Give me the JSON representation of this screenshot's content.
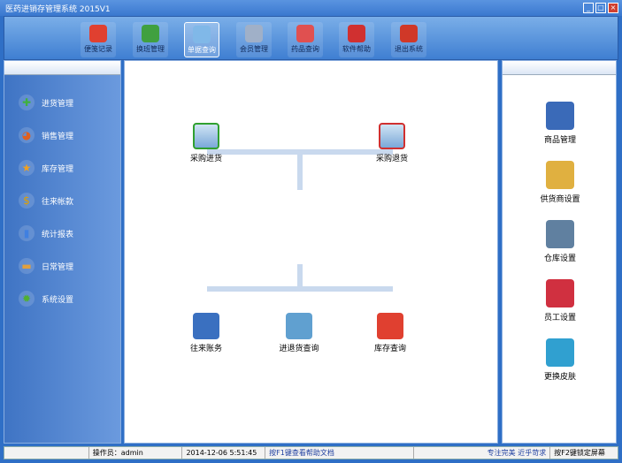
{
  "window": {
    "title": "医药进销存管理系统 2015V1",
    "min": "_",
    "max": "□",
    "close": "×"
  },
  "toolbar": [
    {
      "label": "便笺记录",
      "icon": "notepad-icon",
      "color": "#e04030"
    },
    {
      "label": "换班管理",
      "icon": "users-swap-icon",
      "color": "#40a040"
    },
    {
      "label": "单据查询",
      "icon": "magnifier-icon",
      "color": "#80b8e8",
      "active": true
    },
    {
      "label": "会员管理",
      "icon": "members-icon",
      "color": "#a0b0c8"
    },
    {
      "label": "药品查询",
      "icon": "medicine-icon",
      "color": "#e05050"
    },
    {
      "label": "软件帮助",
      "icon": "help-icon",
      "color": "#d03030"
    },
    {
      "label": "退出系统",
      "icon": "power-icon",
      "color": "#d03828"
    }
  ],
  "sidebar": [
    {
      "label": "进货管理",
      "icon": "plus-icon",
      "color": "#40b040",
      "glyph": "✚"
    },
    {
      "label": "销售管理",
      "icon": "pie-chart-icon",
      "color": "#e06020",
      "glyph": "◕"
    },
    {
      "label": "库存管理",
      "icon": "star-icon",
      "color": "#f0a020",
      "glyph": "★"
    },
    {
      "label": "往来帐款",
      "icon": "dollar-icon",
      "color": "#e0a000",
      "glyph": "$"
    },
    {
      "label": "统计报表",
      "icon": "bar-chart-icon",
      "color": "#4080e0",
      "glyph": "▮"
    },
    {
      "label": "日常管理",
      "icon": "folder-icon",
      "color": "#e0a040",
      "glyph": "▬"
    },
    {
      "label": "系统设置",
      "icon": "gear-icon",
      "color": "#50b030",
      "glyph": "✹"
    }
  ],
  "center": {
    "top": [
      {
        "label": "采购进货",
        "icon": "cart-add-icon"
      },
      {
        "label": "采购退货",
        "icon": "cart-remove-icon"
      }
    ],
    "bottom": [
      {
        "label": "往来账务",
        "icon": "ledger-icon"
      },
      {
        "label": "进退货查询",
        "icon": "return-query-icon"
      },
      {
        "label": "库存查询",
        "icon": "inventory-icon"
      }
    ]
  },
  "right": [
    {
      "label": "商品管理",
      "icon": "goods-icon",
      "color": "#3a6ab8"
    },
    {
      "label": "供货商设置",
      "icon": "supplier-icon",
      "color": "#e0b040"
    },
    {
      "label": "仓库设置",
      "icon": "warehouse-icon",
      "color": "#6080a0"
    },
    {
      "label": "员工设置",
      "icon": "staff-icon",
      "color": "#d03040"
    },
    {
      "label": "更换皮肤",
      "icon": "skin-icon",
      "color": "#30a0d0"
    }
  ],
  "status": {
    "operator": "操作员：admin",
    "datetime": "2014-12-06 5:51:45",
    "help": "按F1键查看帮助文档",
    "slogan": "专注完美 近乎苛求",
    "lock": "按F2键锁定屏幕"
  }
}
